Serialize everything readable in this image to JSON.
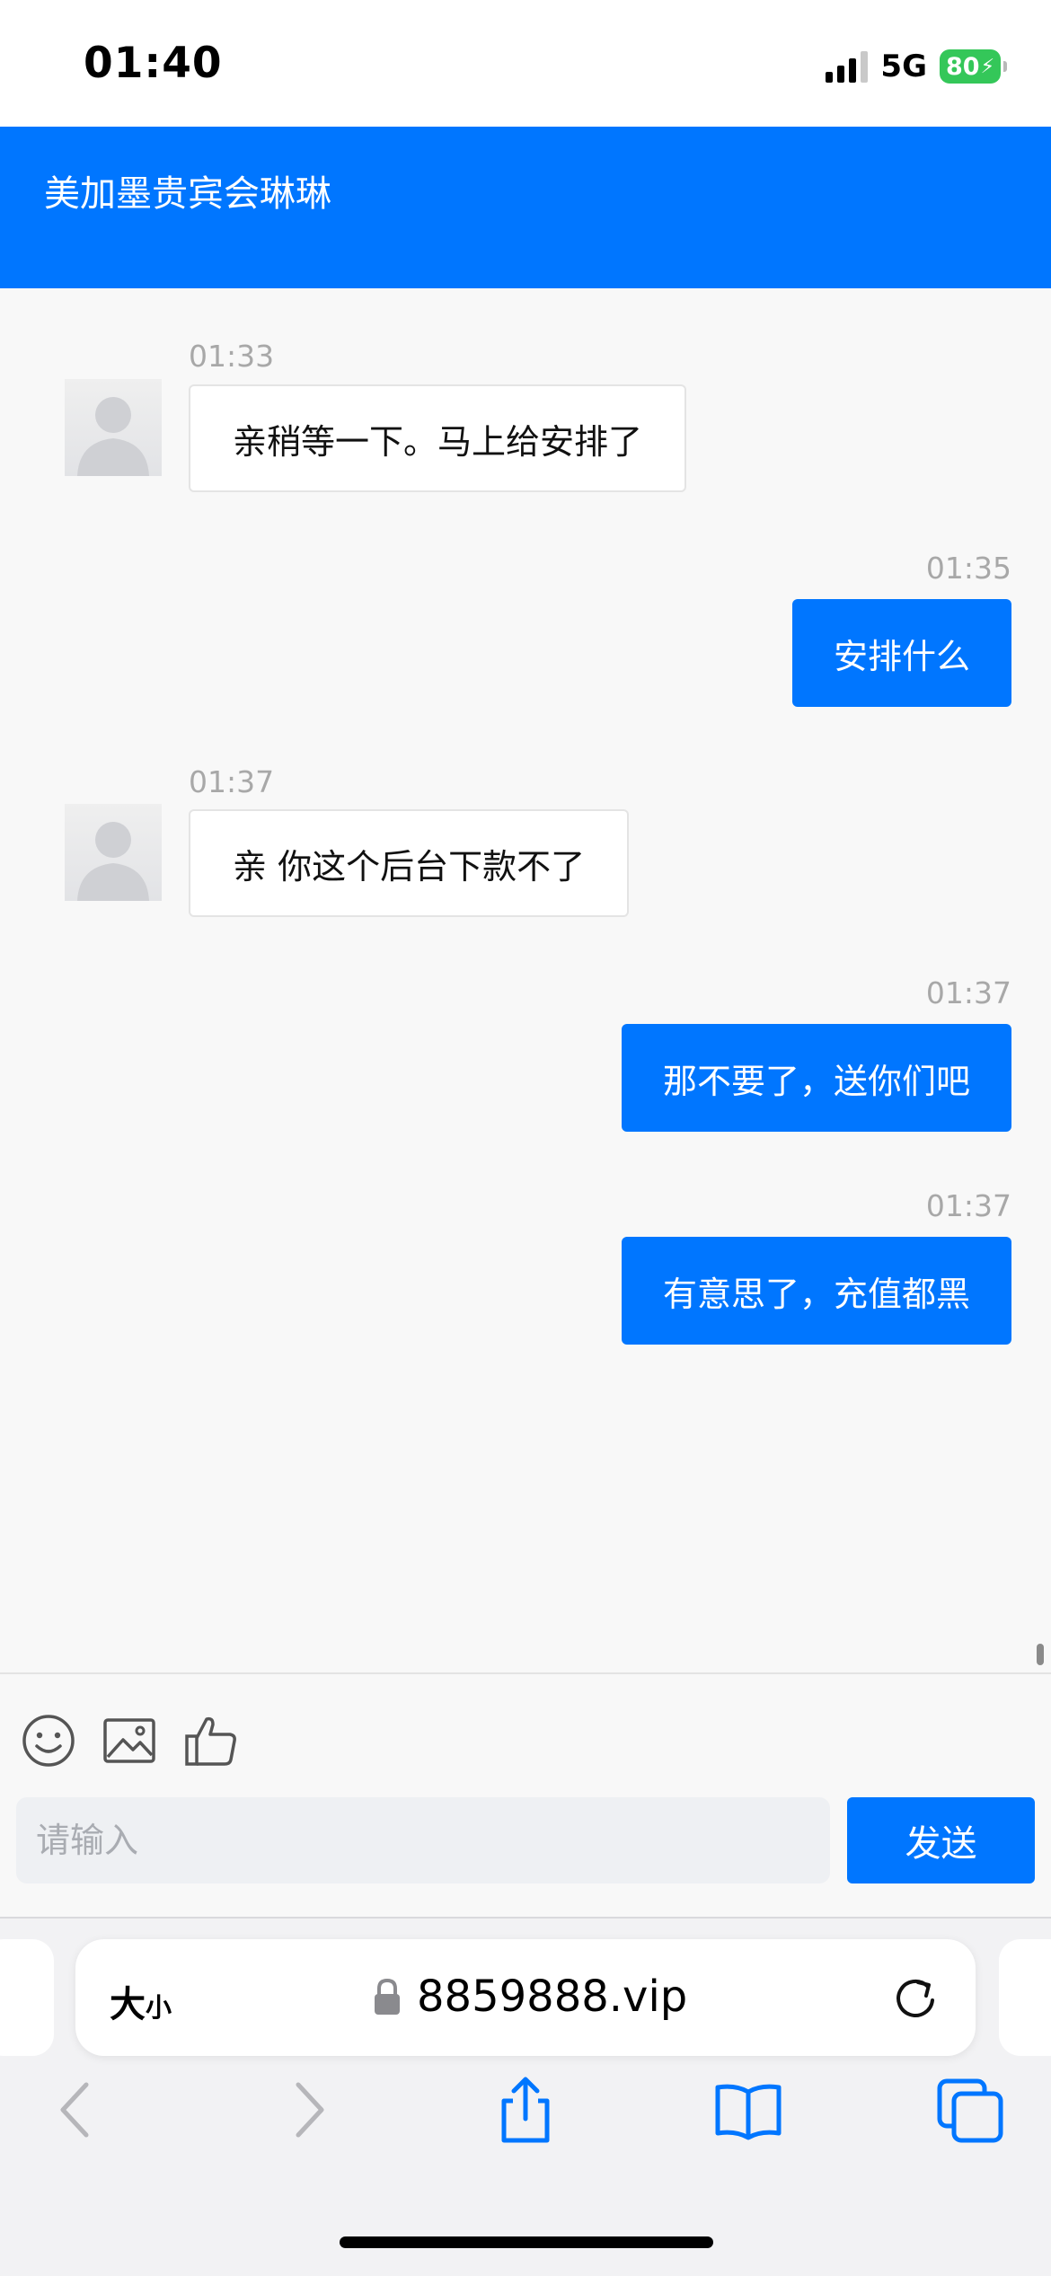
{
  "status_bar": {
    "time": "01:40",
    "network": "5G",
    "battery": "80"
  },
  "header": {
    "title": "美加墨贵宾会琳琳"
  },
  "messages": [
    {
      "direction": "incoming",
      "time": "01:33",
      "text": "亲稍等一下。马上给安排了"
    },
    {
      "direction": "outgoing",
      "time": "01:35",
      "text": "安排什么"
    },
    {
      "direction": "incoming",
      "time": "01:37",
      "text": "亲 你这个后台下款不了"
    },
    {
      "direction": "outgoing",
      "time": "01:37",
      "text": "那不要了，送你们吧"
    },
    {
      "direction": "outgoing",
      "time": "01:37",
      "text": "有意思了，充值都黑"
    }
  ],
  "composer": {
    "tools": [
      "emoji-icon",
      "image-icon",
      "thumbs-up-icon"
    ],
    "placeholder": "请输入",
    "send_label": "发送"
  },
  "browser": {
    "text_size_big": "大",
    "text_size_small": "小",
    "url": "8859888.vip",
    "toolbar": [
      "back-icon",
      "forward-icon",
      "share-icon",
      "bookmarks-icon",
      "tabs-icon"
    ]
  },
  "colors": {
    "accent": "#0076ff",
    "battery_green": "#34c759",
    "background": "#f8f8f8"
  }
}
